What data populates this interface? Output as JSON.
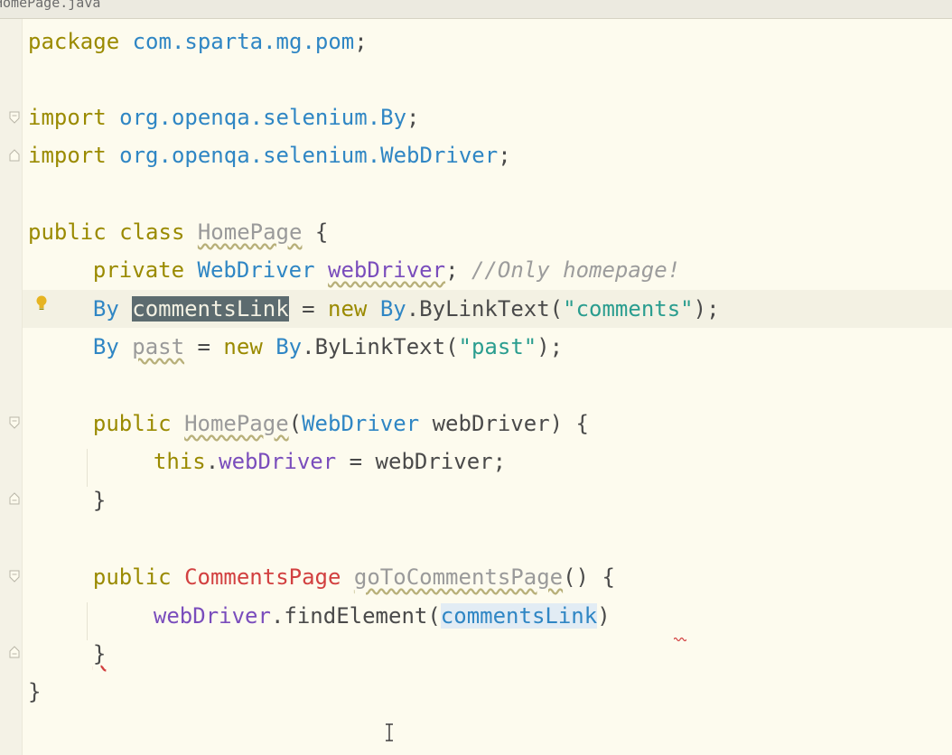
{
  "tab": {
    "title": "HomePage.java"
  },
  "code": {
    "line1": {
      "kw": "package",
      "pkg": "com.sparta.mg.pom",
      "end": ";"
    },
    "line3": {
      "kw": "import",
      "pkg": "org.openqa.selenium.By",
      "end": ";"
    },
    "line4": {
      "kw": "import",
      "pkg": "org.openqa.selenium.WebDriver",
      "end": ";"
    },
    "line6": {
      "kw1": "public",
      "kw2": "class",
      "name": "HomePage",
      "end": " {"
    },
    "line7": {
      "kw": "private",
      "type": "WebDriver",
      "field": "webDriver",
      "semi": ";",
      "comment": "//Only homepage!"
    },
    "line8": {
      "type": "By",
      "field": "commentsLink",
      "eq": " = ",
      "kw": "new",
      "type2": "By",
      "call": ".ByLinkText(",
      "str": "\"comments\"",
      "end": ");"
    },
    "line9": {
      "type": "By",
      "field": "past",
      "eq": " = ",
      "kw": "new",
      "type2": "By",
      "call": ".ByLinkText(",
      "str": "\"past\"",
      "end": ");"
    },
    "line11": {
      "kw": "public",
      "name": "HomePage",
      "open": "(",
      "type": "WebDriver",
      "param": " webDriver",
      "end": ") {"
    },
    "line12": {
      "kw": "this",
      "dot": ".",
      "field": "webDriver",
      "rest": " = webDriver;"
    },
    "line13": {
      "brace": "}"
    },
    "line15": {
      "kw": "public",
      "type": "CommentsPage",
      "method": "goToCommentsPage",
      "end": "() {"
    },
    "line16": {
      "field": "webDriver",
      "call": ".findElement(",
      "ref": "commentsLink",
      "end": ")"
    },
    "line17": {
      "brace": "}"
    },
    "line18": {
      "brace": "}"
    }
  },
  "icons": {
    "bulb": "lightbulb-icon",
    "fold": "fold-marker-icon",
    "cursor": "text-cursor-icon"
  },
  "colors": {
    "background": "#fdfbee",
    "keyword": "#9a8a00",
    "type": "#2f86c4",
    "field": "#7a4dbc",
    "string": "#2a9d8f",
    "comment": "#9c9c9c",
    "selection": "#5c6b6f"
  }
}
